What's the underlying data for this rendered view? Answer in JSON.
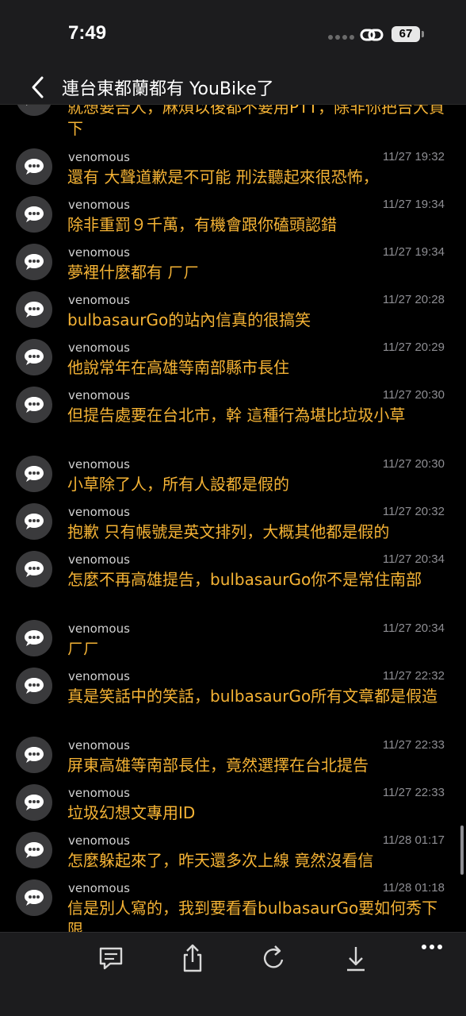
{
  "status": {
    "time": "7:49",
    "battery": "67"
  },
  "nav": {
    "title": "連台東都蘭都有 YouBike了"
  },
  "top_partial": {
    "lines": "就想要告人，麻煩以後都不要用PTT，除非你把台大買下"
  },
  "messages": [
    {
      "name": "venomous",
      "time": "11/27 19:32",
      "text": "還有 大聲道歉是不可能 刑法聽起來很恐怖，"
    },
    {
      "name": "venomous",
      "time": "11/27 19:34",
      "text": "除非重罰９千萬，有機會跟你磕頭認錯"
    },
    {
      "name": "venomous",
      "time": "11/27 19:34",
      "text": "夢裡什麼都有 ㄏㄏ"
    },
    {
      "name": "venomous",
      "time": "11/27 20:28",
      "text": "bulbasaurGo的站內信真的很搞笑"
    },
    {
      "name": "venomous",
      "time": "11/27 20:29",
      "text": "他說常年在高雄等南部縣市長住"
    },
    {
      "name": "venomous",
      "time": "11/27 20:30",
      "text": "但提告處要在台北市，幹 這種行為堪比垃圾小草"
    },
    {
      "name": "venomous",
      "time": "11/27 20:30",
      "text": "小草除了人，所有人設都是假的"
    },
    {
      "name": "venomous",
      "time": "11/27 20:32",
      "text": "抱歉 只有帳號是英文排列，大概其他都是假的"
    },
    {
      "name": "venomous",
      "time": "11/27 20:34",
      "text": "怎麼不再高雄提告，bulbasaurGo你不是常住南部"
    },
    {
      "name": "venomous",
      "time": "11/27 20:34",
      "text": "ㄏㄏ"
    },
    {
      "name": "venomous",
      "time": "11/27 22:32",
      "text": "真是笑話中的笑話，bulbasaurGo所有文章都是假造"
    },
    {
      "name": "venomous",
      "time": "11/27 22:33",
      "text": "屏東高雄等南部長住，竟然選擇在台北提告"
    },
    {
      "name": "venomous",
      "time": "11/27 22:33",
      "text": "垃圾幻想文專用ID"
    },
    {
      "name": "venomous",
      "time": "11/28 01:17",
      "text": "怎麼躲起來了，昨天還多次上線 竟然沒看信"
    },
    {
      "name": "venomous",
      "time": "11/28 01:18",
      "text": "信是別人寫的，我到要看看bulbasaurGo要如何秀下限"
    }
  ],
  "toolbar": {
    "items": [
      "comment-icon",
      "share-icon",
      "refresh-icon",
      "download-icon",
      "more-icon"
    ]
  },
  "colors": {
    "message": "#f5b335",
    "background": "#000000",
    "bar": "#1c1c1e"
  }
}
